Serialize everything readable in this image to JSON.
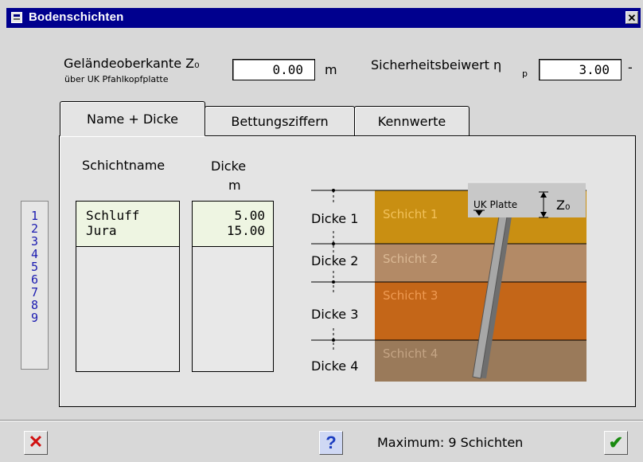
{
  "window": {
    "title": "Bodenschichten"
  },
  "header": {
    "gelaende_label": "Geländeoberkante Z₀",
    "gelaende_sub": "über UK Pfahlkopfplatte",
    "gelaende_value": "0.00",
    "gelaende_unit": "m",
    "sicherheit_label": "Sicherheitsbeiwert η",
    "sicherheit_sub": "p",
    "sicherheit_value": "3.00",
    "sicherheit_unit": "-"
  },
  "tabs": [
    {
      "label": "Name + Dicke",
      "active": true
    },
    {
      "label": "Bettungsziffern",
      "active": false
    },
    {
      "label": "Kennwerte",
      "active": false
    }
  ],
  "columns": {
    "name_header": "Schichtname",
    "dicke_header": "Dicke",
    "dicke_unit": "m"
  },
  "row_numbers": [
    "1",
    "2",
    "3",
    "4",
    "5",
    "6",
    "7",
    "8",
    "9"
  ],
  "layers": [
    {
      "name": "Schluff",
      "dicke": "5.00"
    },
    {
      "name": "Jura",
      "dicke": "15.00"
    }
  ],
  "diagram": {
    "dicke_labels": [
      "Dicke 1",
      "Dicke 2",
      "Dicke 3",
      "Dicke 4"
    ],
    "schicht_labels": [
      "Schicht 1",
      "Schicht 2",
      "Schicht 3",
      "Schicht 4"
    ],
    "platte_label": "UK Platte",
    "z0_label": "Z₀",
    "colors": [
      "#c98f12",
      "#b38a66",
      "#c46618",
      "#9a7a5a"
    ]
  },
  "footer": {
    "status": "Maximum: 9 Schichten"
  }
}
